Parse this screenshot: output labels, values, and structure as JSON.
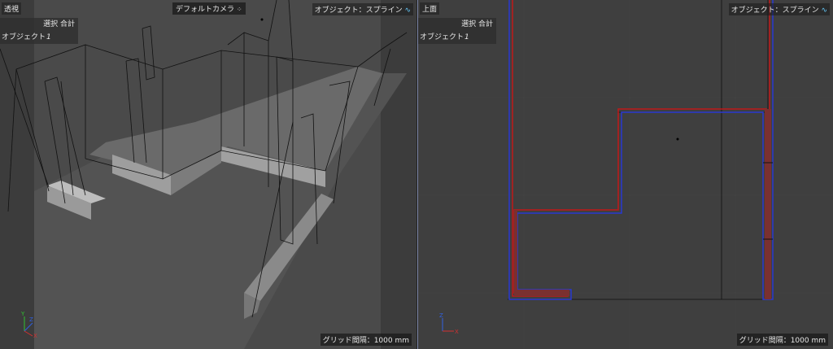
{
  "left_view": {
    "name": "透視",
    "camera": "デフォルトカメラ",
    "display_mode": "オブジェクト：スプライン",
    "stats_header": "選択 合計",
    "stats_label": "オブジェクト",
    "stats_value": "1",
    "grid_label": "グリッド間隔：1000 mm"
  },
  "right_view": {
    "name": "上面",
    "display_mode": "オブジェクト：スプライン",
    "stats_header": "選択 合計",
    "stats_label": "オブジェクト",
    "stats_value": "1",
    "grid_label": "グリッド間隔：1000 mm"
  },
  "axes_left": {
    "x": "X",
    "y": "Y",
    "z": "Z"
  },
  "axes_right": {
    "x": "X",
    "z": "Z"
  },
  "colors": {
    "spline_red": "#c01818",
    "spline_blue": "#2838d0",
    "axis_x": "#d03030",
    "axis_y": "#30c030",
    "axis_z": "#3060e0"
  }
}
